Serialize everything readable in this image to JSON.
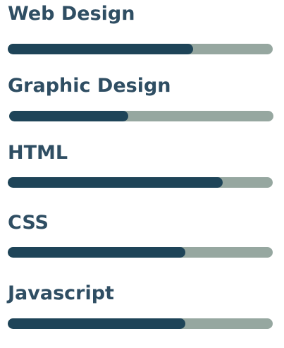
{
  "skills": [
    {
      "label": "Web Design",
      "percent": 70
    },
    {
      "label": "Graphic Design",
      "percent": 45
    },
    {
      "label": "HTML",
      "percent": 81
    },
    {
      "label": "CSS",
      "percent": 67
    },
    {
      "label": "Javascript",
      "percent": 67
    }
  ],
  "colors": {
    "label": "#2f4e63",
    "fill": "#1e4458",
    "track": "#96a7a0"
  }
}
